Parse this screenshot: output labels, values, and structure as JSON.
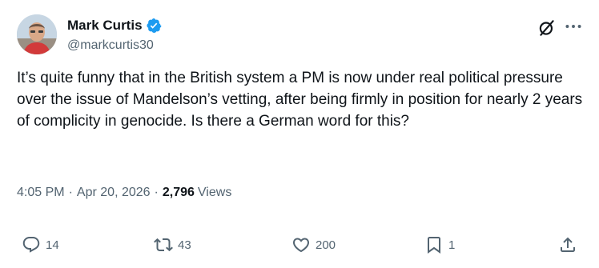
{
  "author": {
    "display_name": "Mark Curtis",
    "handle": "@markcurtis30",
    "verified": true
  },
  "post": {
    "text": "It’s quite funny that in the British system a PM is now under real political pressure over the issue of Mandelson’s vetting, after being firmly in position for nearly 2 years of complicity in genocide.  Is there a German word for this?",
    "time": "4:05 PM",
    "separator": "·",
    "date": "Apr 20, 2026",
    "views_count": "2,796",
    "views_label": "Views"
  },
  "actions": {
    "replies": "14",
    "reposts": "43",
    "likes": "200",
    "bookmarks": "1"
  },
  "colors": {
    "text": "#0f1419",
    "secondary": "#536471",
    "verified": "#1d9bf0"
  },
  "icons": [
    "verified-badge-icon",
    "grok-icon",
    "more-icon",
    "reply-icon",
    "repost-icon",
    "like-icon",
    "bookmark-icon",
    "share-icon"
  ]
}
